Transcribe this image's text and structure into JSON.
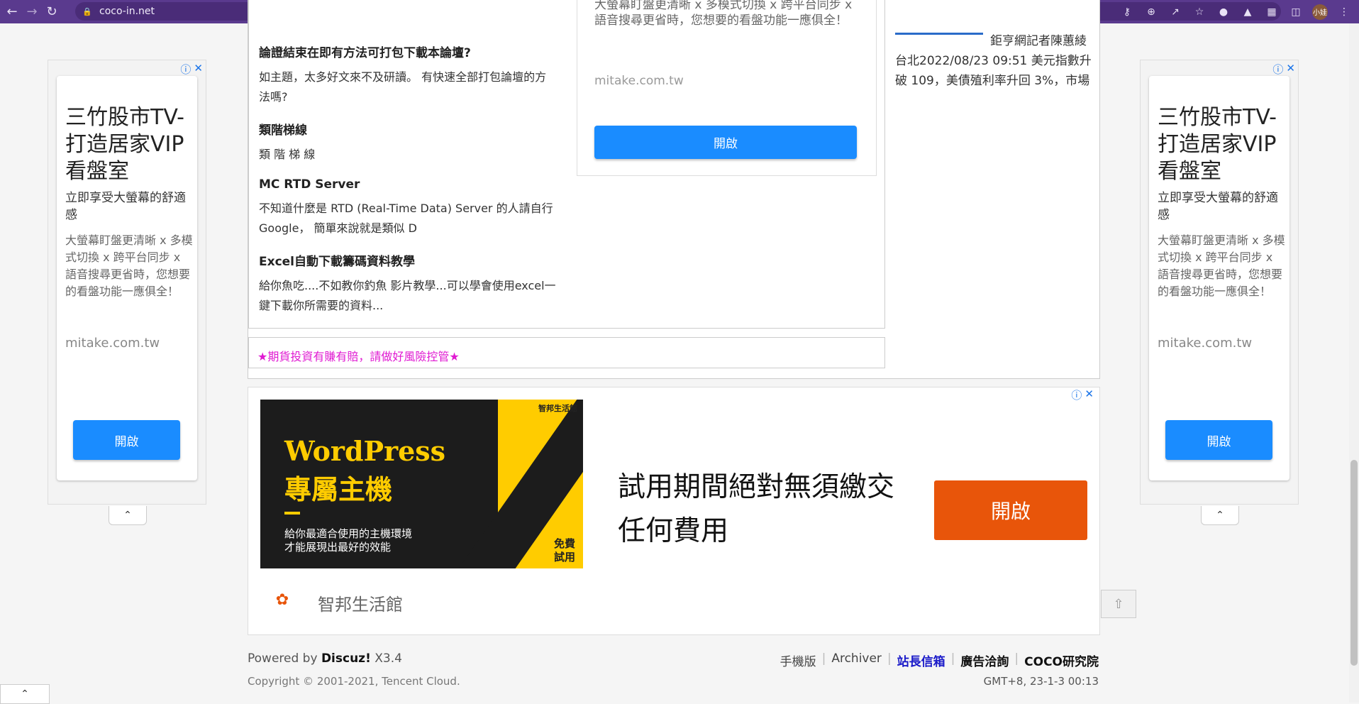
{
  "browser": {
    "url": "coco-in.net",
    "profile": "小娃"
  },
  "side_ad": {
    "title": "三竹股市TV-打造居家VIP看盤室",
    "subtitle": "立即享受大螢幕的舒適感",
    "description": "大螢幕盯盤更清晰 x 多模式切換 x 跨平台同步 x 語音搜尋更省時，您想要的看盤功能一應俱全！",
    "domain": "mitake.com.tw",
    "button": "開啟"
  },
  "posts": [
    {
      "title": "論證結束在即有方法可打包下載本論壇?",
      "desc": "如主題，太多好文來不及研讀。 有快速全部打包論壇的方法嗎?"
    },
    {
      "title": "類階梯線",
      "desc": "類 階 梯 線"
    },
    {
      "title": "MC RTD Server",
      "desc": "不知道什麼是 RTD (Real-Time Data) Server 的人請自行 Google， 簡單來說就是類似 D"
    },
    {
      "title": "Excel自動下載籌碼資料教學",
      "desc": "給你魚吃....不如教你釣魚 影片教學...可以學會使用excel一鍵下載你所需要的資料..."
    }
  ],
  "mid_ad": {
    "text": "大螢幕盯盤更清晰 x 多模式切換 x 跨平台同步 x 語音搜尋更省時，您想要的看盤功能一應俱全！",
    "domain": "mitake.com.tw",
    "button": "開啟"
  },
  "news": {
    "text": "鉅亨網記者陳蕙綾 台北2022/08/23 09:51 美元指數升破 109，美債殖利率升回 3%，市場"
  },
  "warning": "★期貨投資有賺有賠，請做好風險控管★",
  "banner": {
    "img_line1": "WordPress",
    "img_line2": "專屬主機",
    "img_small1": "給你最適合使用的主機環境",
    "img_small2": "才能展現出最好的效能",
    "img_badge": "免費試用",
    "img_logo": "智邦生活館",
    "headline": "試用期間絕對無須繳交任何費用",
    "cta": "開啟",
    "brand": "智邦生活館"
  },
  "footer": {
    "powered": "Powered by",
    "discuz": "Discuz!",
    "version": "X3.4",
    "copyright": "Copyright © 2001-2021, Tencent Cloud.",
    "links": [
      "手機版",
      "Archiver",
      "站長信箱",
      "廣告洽詢",
      "COCO研究院"
    ],
    "time": "GMT+8, 23-1-3 00:13"
  }
}
